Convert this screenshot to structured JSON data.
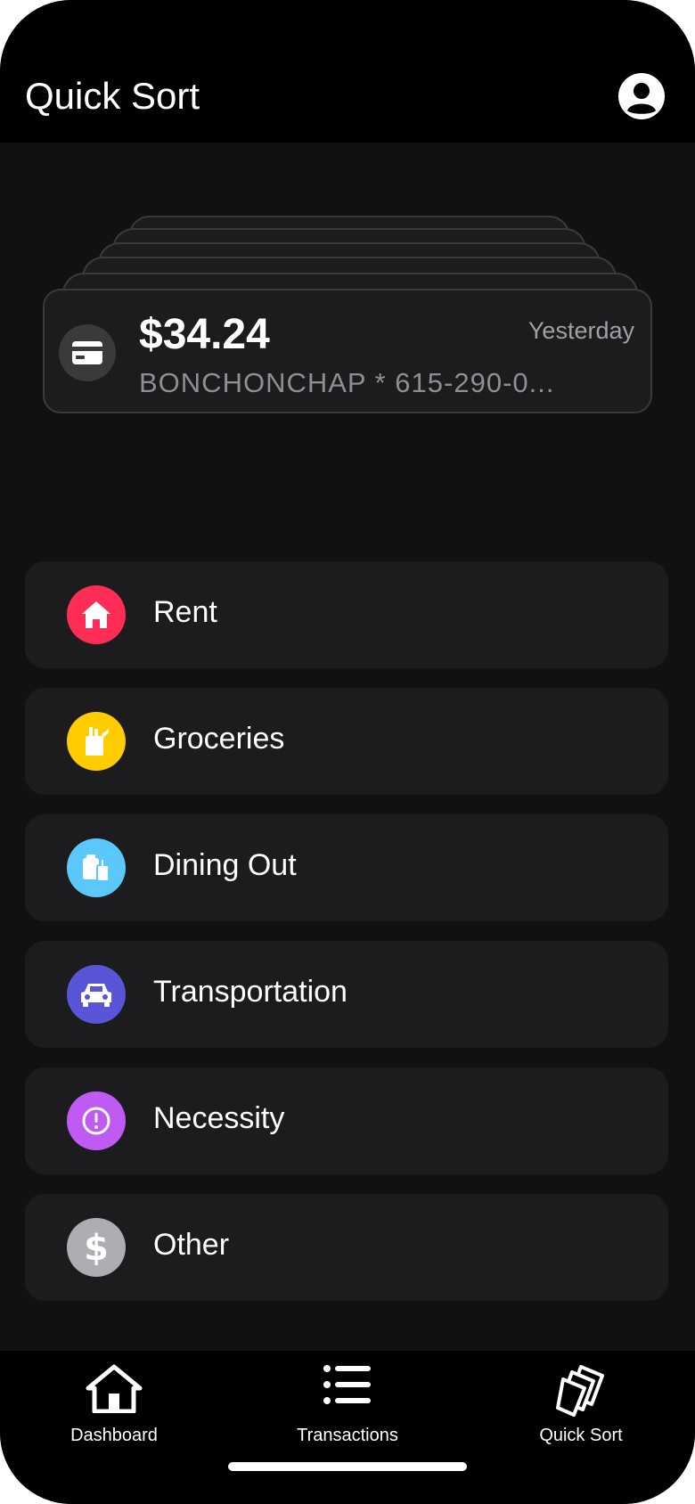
{
  "header": {
    "title": "Quick Sort",
    "profile_icon": "person-circle-icon"
  },
  "transaction": {
    "amount": "$34.24",
    "merchant": "BONCHONCHAP * 615-290-0...",
    "date": "Yesterday",
    "icon": "credit-card-icon"
  },
  "categories": [
    {
      "label": "Rent",
      "color": "#ff2d55",
      "icon": "house-icon"
    },
    {
      "label": "Groceries",
      "color": "#ffcc00",
      "icon": "grocery-bag-icon"
    },
    {
      "label": "Dining Out",
      "color": "#5ac8fa",
      "icon": "takeout-icon"
    },
    {
      "label": "Transportation",
      "color": "#5856d6",
      "icon": "car-icon"
    },
    {
      "label": "Necessity",
      "color": "#bf5af2",
      "icon": "exclamation-circle-icon"
    },
    {
      "label": "Other",
      "color": "#8e8e93",
      "icon": "dollar-sign-icon"
    }
  ],
  "tabbar": {
    "tabs": [
      {
        "label": "Dashboard",
        "icon": "house-icon"
      },
      {
        "label": "Transactions",
        "icon": "list-icon"
      },
      {
        "label": "Quick Sort",
        "icon": "stacked-cards-icon"
      }
    ]
  }
}
